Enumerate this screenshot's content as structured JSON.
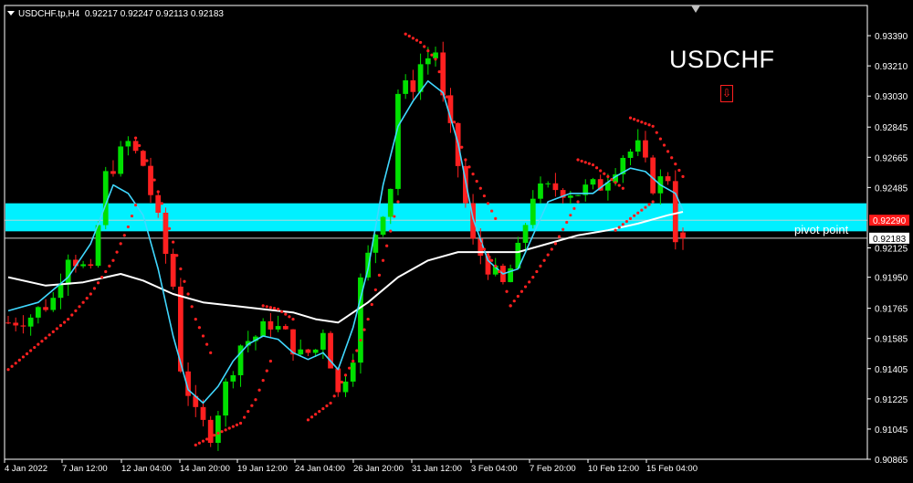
{
  "header": {
    "symbol_label": "USDCHF.tp,H4",
    "ohlc": "0.92217 0.92247 0.92113 0.92183"
  },
  "annotations": {
    "title": "USDCHF",
    "pivot_label": "pivot point",
    "signal_icon": "down-arrow-icon"
  },
  "colors": {
    "background": "#000000",
    "bull_candle": "#00e000",
    "bear_candle": "#ff2020",
    "fast_ma": "#40d8ff",
    "slow_ma": "#ffffff",
    "parabolic_sar": "#ff2020",
    "zone": "#00f0ff",
    "grid_text": "#ffffff",
    "current_price_badge": "#ff1a1a"
  },
  "chart_data": {
    "type": "candlestick",
    "title": "USDCHF",
    "series_label": "USDCHF.tp,H4",
    "ylim": [
      0.90865,
      0.9357
    ],
    "y_ticks": [
      "0.93390",
      "0.93210",
      "0.93030",
      "0.92845",
      "0.92665",
      "0.92485",
      "0.92125",
      "0.91950",
      "0.91765",
      "0.91585",
      "0.91405",
      "0.91225",
      "0.91045",
      "0.90865"
    ],
    "x_ticks": [
      "4 Jan 2022",
      "7 Jan 12:00",
      "12 Jan 04:00",
      "14 Jan 20:00",
      "19 Jan 12:00",
      "24 Jan 04:00",
      "26 Jan 20:00",
      "31 Jan 12:00",
      "3 Feb 04:00",
      "7 Feb 20:00",
      "10 Feb 12:00",
      "15 Feb 04:00"
    ],
    "resistance_zone": [
      0.923,
      0.9238
    ],
    "pivot_level": 0.92183,
    "price_badges": [
      {
        "value": "0.92290",
        "kind": "ask"
      },
      {
        "value": "0.92183",
        "kind": "bid"
      }
    ],
    "ohlc_last": {
      "open": 0.92217,
      "high": 0.92247,
      "low": 0.92113,
      "close": 0.92183
    },
    "price_path": [
      [
        0,
        0.9168
      ],
      [
        3,
        0.9172
      ],
      [
        6,
        0.9182
      ],
      [
        8,
        0.921
      ],
      [
        11,
        0.9196
      ],
      [
        13,
        0.9255
      ],
      [
        16,
        0.9275
      ],
      [
        18,
        0.9262
      ],
      [
        20,
        0.9228
      ],
      [
        22,
        0.919
      ],
      [
        23,
        0.9142
      ],
      [
        25,
        0.9112
      ],
      [
        27,
        0.9102
      ],
      [
        29,
        0.913
      ],
      [
        31,
        0.9155
      ],
      [
        33,
        0.916
      ],
      [
        35,
        0.9168
      ],
      [
        37,
        0.916
      ],
      [
        39,
        0.9148
      ],
      [
        41,
        0.9152
      ],
      [
        42,
        0.9165
      ],
      [
        44,
        0.9125
      ],
      [
        46,
        0.915
      ],
      [
        47,
        0.9192
      ],
      [
        49,
        0.9222
      ],
      [
        51,
        0.925
      ],
      [
        52,
        0.9305
      ],
      [
        54,
        0.931
      ],
      [
        55,
        0.9322
      ],
      [
        57,
        0.933
      ],
      [
        58,
        0.93
      ],
      [
        60,
        0.9262
      ],
      [
        62,
        0.9215
      ],
      [
        64,
        0.9202
      ],
      [
        66,
        0.919
      ],
      [
        68,
        0.921
      ],
      [
        70,
        0.9245
      ],
      [
        73,
        0.9248
      ],
      [
        76,
        0.9246
      ],
      [
        79,
        0.925
      ],
      [
        82,
        0.9268
      ],
      [
        84,
        0.9272
      ],
      [
        86,
        0.925
      ],
      [
        88,
        0.9255
      ],
      [
        89,
        0.922
      ],
      [
        90,
        0.9218
      ]
    ],
    "fast_ma_path": [
      [
        0,
        0.9175
      ],
      [
        4,
        0.918
      ],
      [
        8,
        0.9195
      ],
      [
        11,
        0.9215
      ],
      [
        14,
        0.925
      ],
      [
        16,
        0.9245
      ],
      [
        18,
        0.9232
      ],
      [
        20,
        0.92
      ],
      [
        22,
        0.916
      ],
      [
        24,
        0.9128
      ],
      [
        26,
        0.912
      ],
      [
        28,
        0.913
      ],
      [
        30,
        0.9145
      ],
      [
        32,
        0.9155
      ],
      [
        34,
        0.916
      ],
      [
        36,
        0.9158
      ],
      [
        38,
        0.915
      ],
      [
        40,
        0.9146
      ],
      [
        42,
        0.915
      ],
      [
        44,
        0.914
      ],
      [
        46,
        0.9165
      ],
      [
        48,
        0.92
      ],
      [
        50,
        0.925
      ],
      [
        52,
        0.9285
      ],
      [
        54,
        0.93
      ],
      [
        56,
        0.9312
      ],
      [
        58,
        0.9305
      ],
      [
        60,
        0.9275
      ],
      [
        62,
        0.923
      ],
      [
        64,
        0.9205
      ],
      [
        66,
        0.9197
      ],
      [
        68,
        0.92
      ],
      [
        70,
        0.922
      ],
      [
        72,
        0.924
      ],
      [
        75,
        0.9245
      ],
      [
        78,
        0.9245
      ],
      [
        81,
        0.9255
      ],
      [
        83,
        0.926
      ],
      [
        85,
        0.9258
      ],
      [
        87,
        0.925
      ],
      [
        89,
        0.9245
      ],
      [
        90,
        0.9235
      ]
    ],
    "slow_ma_path": [
      [
        0,
        0.9195
      ],
      [
        5,
        0.919
      ],
      [
        10,
        0.9192
      ],
      [
        15,
        0.9197
      ],
      [
        18,
        0.9193
      ],
      [
        22,
        0.9185
      ],
      [
        26,
        0.918
      ],
      [
        30,
        0.9178
      ],
      [
        34,
        0.9176
      ],
      [
        38,
        0.9174
      ],
      [
        41,
        0.917
      ],
      [
        44,
        0.9168
      ],
      [
        48,
        0.918
      ],
      [
        52,
        0.9195
      ],
      [
        56,
        0.9205
      ],
      [
        60,
        0.921
      ],
      [
        64,
        0.921
      ],
      [
        68,
        0.921
      ],
      [
        72,
        0.9215
      ],
      [
        76,
        0.922
      ],
      [
        80,
        0.9223
      ],
      [
        84,
        0.9227
      ],
      [
        88,
        0.9232
      ],
      [
        90,
        0.9234
      ]
    ],
    "sar_segments": [
      [
        [
          0,
          0.914
        ],
        [
          4,
          0.9155
        ],
        [
          8,
          0.917
        ],
        [
          11,
          0.9185
        ],
        [
          14,
          0.9205
        ],
        [
          16,
          0.9225
        ],
        [
          17,
          0.9238
        ]
      ],
      [
        [
          17,
          0.9278
        ],
        [
          19,
          0.926
        ],
        [
          21,
          0.9232
        ],
        [
          23,
          0.92
        ],
        [
          25,
          0.917
        ],
        [
          27,
          0.915
        ]
      ],
      [
        [
          25,
          0.9095
        ],
        [
          28,
          0.9102
        ],
        [
          31,
          0.9108
        ],
        [
          33,
          0.9122
        ],
        [
          35,
          0.9145
        ]
      ],
      [
        [
          34,
          0.9178
        ],
        [
          36,
          0.9176
        ],
        [
          38,
          0.917
        ]
      ],
      [
        [
          40,
          0.911
        ],
        [
          43,
          0.912
        ],
        [
          46,
          0.9145
        ],
        [
          48,
          0.917
        ],
        [
          50,
          0.9205
        ],
        [
          52,
          0.924
        ]
      ],
      [
        [
          53,
          0.934
        ],
        [
          55,
          0.9335
        ],
        [
          57,
          0.9325
        ],
        [
          59,
          0.9295
        ],
        [
          61,
          0.9265
        ],
        [
          63,
          0.9248
        ],
        [
          65,
          0.923
        ]
      ],
      [
        [
          63,
          0.9215
        ],
        [
          66,
          0.9195
        ],
        [
          67,
          0.9178
        ]
      ],
      [
        [
          67,
          0.9178
        ],
        [
          70,
          0.9195
        ],
        [
          73,
          0.9215
        ],
        [
          75,
          0.9232
        ],
        [
          76,
          0.924
        ]
      ],
      [
        [
          76,
          0.9265
        ],
        [
          78,
          0.9262
        ],
        [
          80,
          0.9255
        ],
        [
          82,
          0.9248
        ]
      ],
      [
        [
          81,
          0.9223
        ],
        [
          83,
          0.923
        ],
        [
          86,
          0.924
        ]
      ],
      [
        [
          83,
          0.929
        ],
        [
          86,
          0.9285
        ],
        [
          88,
          0.927
        ],
        [
          90,
          0.9255
        ]
      ]
    ]
  }
}
